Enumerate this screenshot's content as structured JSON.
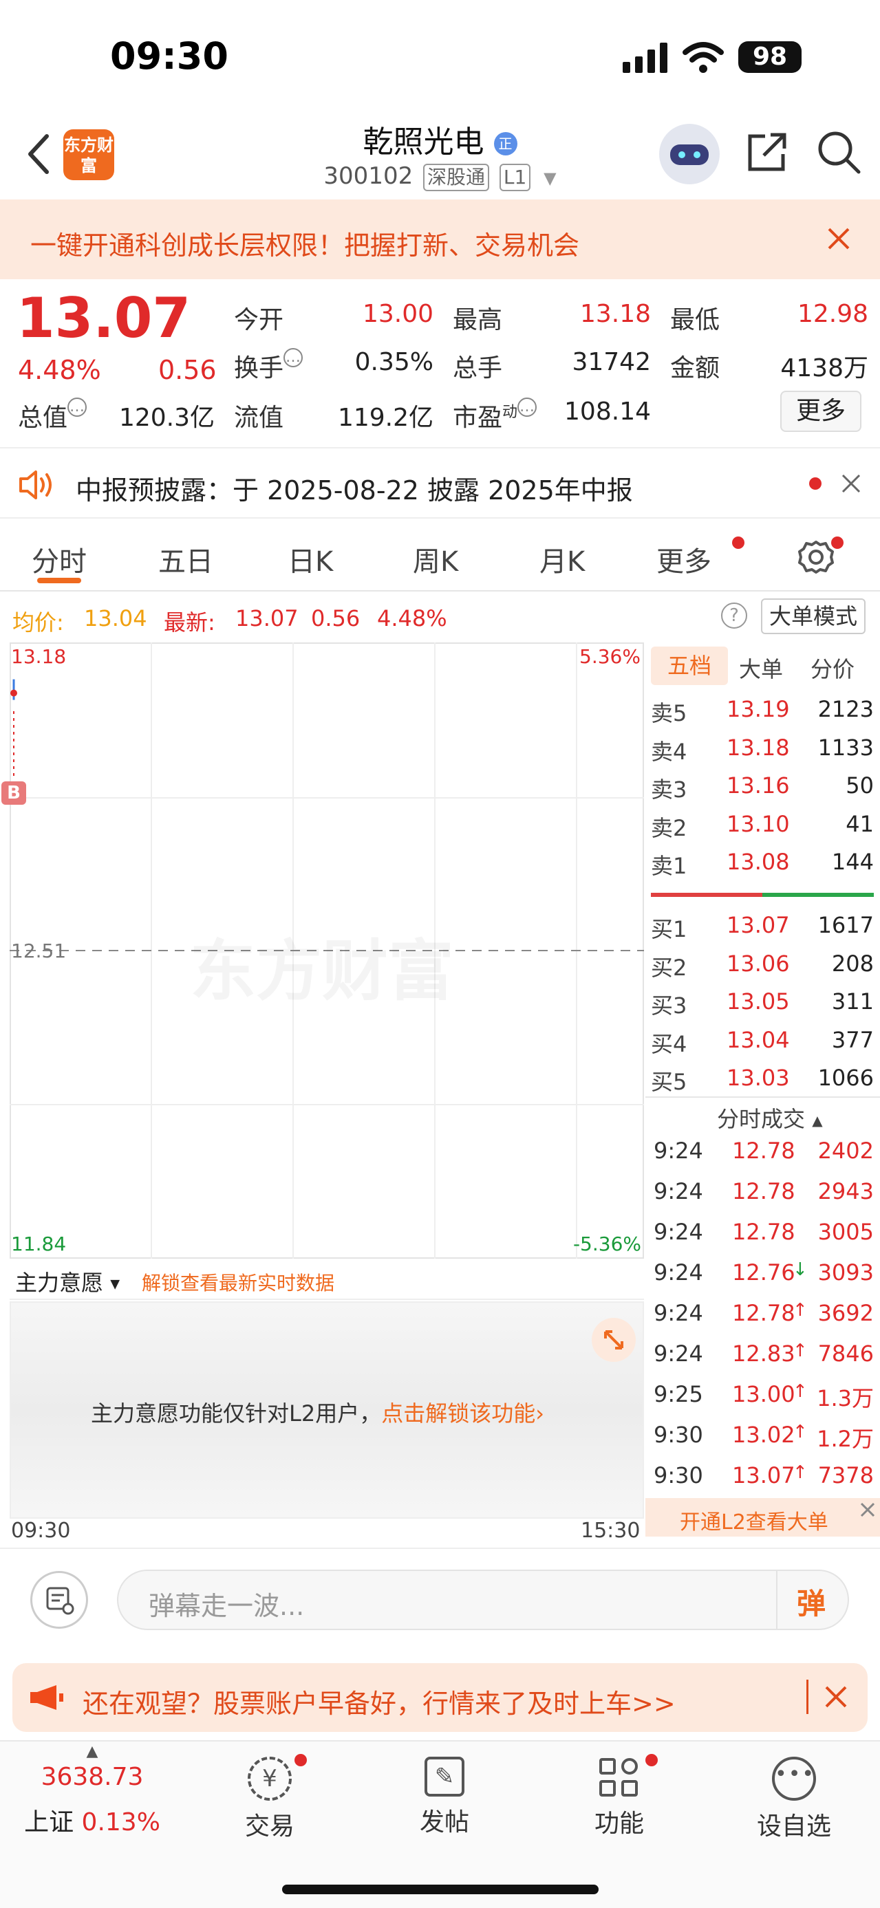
{
  "status_bar": {
    "time": "09:30",
    "battery": "98"
  },
  "header": {
    "logo_text": "东方财富",
    "title": "乾照光电",
    "badge": "正",
    "code": "300102",
    "tag1": "深股通",
    "tag2": "L1"
  },
  "banner": {
    "text": "一键开通科创成长层权限！把握打新、交易机会"
  },
  "quote": {
    "price": "13.07",
    "change_pct": "4.48%",
    "change": "0.56",
    "open_label": "今开",
    "open": "13.00",
    "high_label": "最高",
    "high": "13.18",
    "low_label": "最低",
    "low": "12.98",
    "turnover_label": "换手",
    "turnover": "0.35%",
    "volume_label": "总手",
    "volume": "31742",
    "amount_label": "金额",
    "amount": "4138万",
    "mcap_label": "总值",
    "mcap": "120.3亿",
    "float_label": "流值",
    "float": "119.2亿",
    "pe_label": "市盈",
    "pe_sup": "动",
    "pe": "108.14",
    "more": "更多"
  },
  "notice": {
    "text": "中报预披露：于 2025-08-22 披露 2025年中报"
  },
  "tabs": [
    "分时",
    "五日",
    "日K",
    "周K",
    "月K",
    "更多"
  ],
  "info_row": {
    "avg_label": "均价:",
    "avg": "13.04",
    "latest_label": "最新:",
    "latest": "13.07",
    "chg": "0.56",
    "chg_pct": "4.48%",
    "mode_btn": "大单模式"
  },
  "chart": {
    "y_top": "13.18",
    "y_mid": "12.51",
    "y_bot": "11.84",
    "pct_top": "5.36%",
    "pct_bot": "-5.36%",
    "watermark": "东方财富",
    "x_start": "09:30",
    "x_end": "15:30",
    "marker": "B"
  },
  "chart_data": {
    "type": "line",
    "x": [
      "09:30"
    ],
    "series": [
      {
        "values": [
          13.07
        ]
      }
    ],
    "ylim": [
      11.84,
      13.18
    ]
  },
  "order_book": {
    "tabs": [
      "五档",
      "大单",
      "分价"
    ],
    "asks": [
      {
        "label": "卖5",
        "price": "13.19",
        "vol": "2123"
      },
      {
        "label": "卖4",
        "price": "13.18",
        "vol": "1133"
      },
      {
        "label": "卖3",
        "price": "13.16",
        "vol": "50"
      },
      {
        "label": "卖2",
        "price": "13.10",
        "vol": "41"
      },
      {
        "label": "卖1",
        "price": "13.08",
        "vol": "144"
      }
    ],
    "bids": [
      {
        "label": "买1",
        "price": "13.07",
        "vol": "1617"
      },
      {
        "label": "买2",
        "price": "13.06",
        "vol": "208"
      },
      {
        "label": "买3",
        "price": "13.05",
        "vol": "311"
      },
      {
        "label": "买4",
        "price": "13.04",
        "vol": "377"
      },
      {
        "label": "买5",
        "price": "13.03",
        "vol": "1066"
      }
    ]
  },
  "ticks": {
    "header": "分时成交",
    "rows": [
      {
        "t": "9:24",
        "p": "12.78",
        "a": "",
        "v": "2402"
      },
      {
        "t": "9:24",
        "p": "12.78",
        "a": "",
        "v": "2943"
      },
      {
        "t": "9:24",
        "p": "12.78",
        "a": "",
        "v": "3005"
      },
      {
        "t": "9:24",
        "p": "12.76",
        "a": "↓",
        "v": "3093"
      },
      {
        "t": "9:24",
        "p": "12.78",
        "a": "↑",
        "v": "3692"
      },
      {
        "t": "9:24",
        "p": "12.83",
        "a": "↑",
        "v": "7846"
      },
      {
        "t": "9:25",
        "p": "13.00",
        "a": "↑",
        "v": "1.3万"
      },
      {
        "t": "9:30",
        "p": "13.02",
        "a": "↑",
        "v": "1.2万"
      },
      {
        "t": "9:30",
        "p": "13.07",
        "a": "↑",
        "v": "7378"
      }
    ],
    "footer": "开通L2查看大单"
  },
  "main_will": {
    "dropdown": "主力意愿",
    "unlock_hint": "解锁查看最新实时数据",
    "message": "主力意愿功能仅针对L2用户，",
    "link": "点击解锁该功能"
  },
  "comment": {
    "placeholder": "弹幕走一波...",
    "send_label": "弹"
  },
  "promo": {
    "text": "还在观望？股票账户早备好，行情来了及时上车>>"
  },
  "tabbar": {
    "index_value": "3638.73",
    "index_name": "上证",
    "index_pct": "0.13%",
    "items": [
      "交易",
      "发帖",
      "功能",
      "设自选"
    ]
  }
}
